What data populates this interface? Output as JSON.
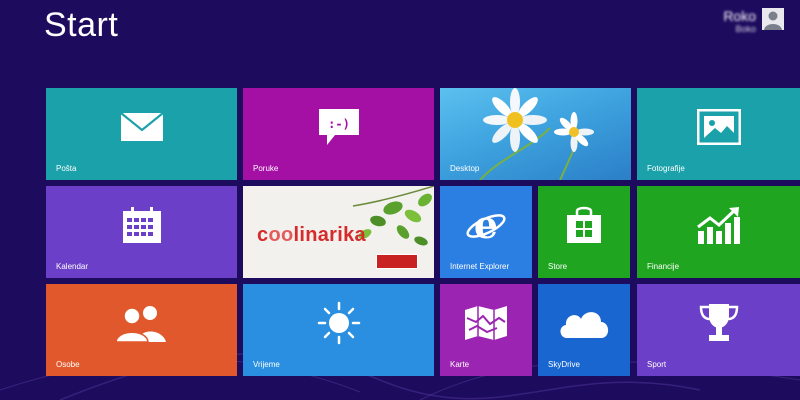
{
  "header": {
    "title": "Start",
    "user_name": "Roko",
    "user_sub": "Boko"
  },
  "colors": {
    "background": "#1d0b5e",
    "mail": "#1ba1a9",
    "messages": "#a40fa4",
    "photos": "#1ba1a9",
    "calendar": "#6b3fc7",
    "ie": "#2c7fe2",
    "store": "#1fa51f",
    "finance": "#1fa51f",
    "people": "#e0582b",
    "weather": "#2a8fe0",
    "maps": "#9b24b2",
    "skydrive": "#1a66d0",
    "sport": "#6b3fc7"
  },
  "tiles": {
    "mail": {
      "label": "Pošta",
      "icon": "envelope-icon"
    },
    "messages": {
      "label": "Poruke",
      "icon": "chat-smiley-icon",
      "glyph": ":-)"
    },
    "desktop": {
      "label": "Desktop",
      "icon": "daisy-wallpaper"
    },
    "photos": {
      "label": "Fotografije",
      "icon": "picture-icon"
    },
    "calendar": {
      "label": "Kalendar",
      "icon": "calendar-icon"
    },
    "coolinarika": {
      "text_a": "c",
      "text_oo": "oo",
      "text_b": "linarika",
      "icon": "coolinarika-logo"
    },
    "ie": {
      "label": "Internet Explorer",
      "icon": "ie-icon"
    },
    "store": {
      "label": "Store",
      "icon": "store-bag-icon"
    },
    "finance": {
      "label": "Financije",
      "icon": "chart-up-icon"
    },
    "people": {
      "label": "Osobe",
      "icon": "people-icon"
    },
    "weather": {
      "label": "Vrijeme",
      "icon": "sun-icon"
    },
    "maps": {
      "label": "Karte",
      "icon": "map-icon"
    },
    "skydrive": {
      "label": "SkyDrive",
      "icon": "cloud-icon"
    },
    "sport": {
      "label": "Sport",
      "icon": "trophy-icon"
    }
  }
}
